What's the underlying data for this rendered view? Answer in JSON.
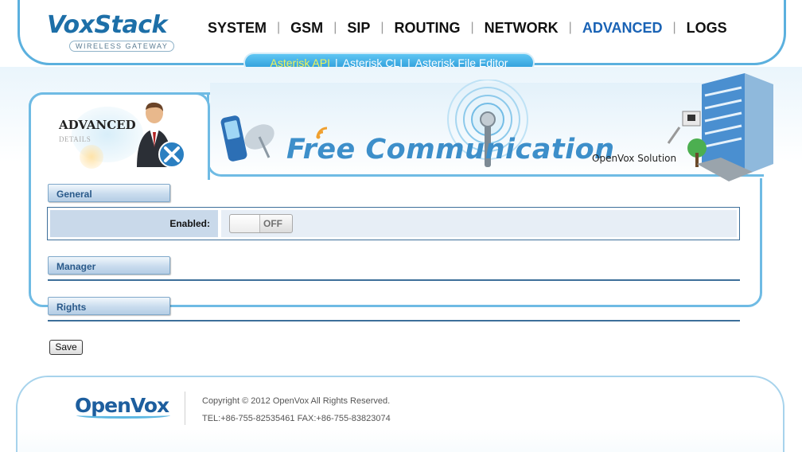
{
  "brand": {
    "name": "VoxStack",
    "tagline": "WIRELESS GATEWAY"
  },
  "main_nav": [
    {
      "label": "SYSTEM",
      "active": false
    },
    {
      "label": "GSM",
      "active": false
    },
    {
      "label": "SIP",
      "active": false
    },
    {
      "label": "ROUTING",
      "active": false
    },
    {
      "label": "NETWORK",
      "active": false
    },
    {
      "label": "ADVANCED",
      "active": true
    },
    {
      "label": "LOGS",
      "active": false
    }
  ],
  "sub_nav": [
    {
      "label": "Asterisk API",
      "active": true
    },
    {
      "label": "Asterisk CLI",
      "active": false
    },
    {
      "label": "Asterisk File Editor",
      "active": false
    }
  ],
  "page": {
    "title": "ADVANCED",
    "subtitle": "DETAILS"
  },
  "banner": {
    "headline": "Free Communication",
    "sub": "OpenVox Solution"
  },
  "sections": {
    "general": {
      "label": "General",
      "fields": [
        {
          "label": "Enabled:",
          "value": "OFF"
        }
      ]
    },
    "manager": {
      "label": "Manager"
    },
    "rights": {
      "label": "Rights"
    }
  },
  "actions": {
    "save_label": "Save"
  },
  "footer": {
    "logo": "OpenVox",
    "copyright": "Copyright © 2012 OpenVox All Rights Reserved.",
    "contact": "TEL:+86-755-82535461 FAX:+86-755-83823074"
  },
  "colors": {
    "accent": "#1a63b5",
    "frame": "#6fbbe4",
    "section_button": "#c9dcee",
    "sub_nav_active": "#eef45a"
  },
  "icons": {
    "page_tab": "businessman-tools-icon",
    "banner_left": "mobile-phone-satellite-icon",
    "banner_center": "antenna-signal-icon",
    "banner_right": "office-building-network-icon"
  }
}
